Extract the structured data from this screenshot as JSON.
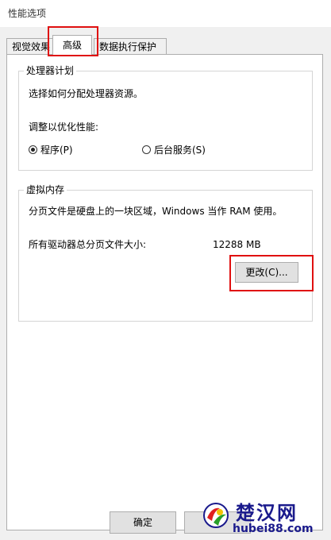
{
  "window": {
    "title": "性能选项"
  },
  "tabs": [
    {
      "label": "视觉效果"
    },
    {
      "label": "高级"
    },
    {
      "label": "数据执行保护"
    }
  ],
  "processor": {
    "title": "处理器计划",
    "description": "选择如何分配处理器资源。",
    "adjust_label": "调整以优化性能:",
    "option_programs": "程序(P)",
    "option_services": "后台服务(S)",
    "selected": "programs"
  },
  "virtual_memory": {
    "title": "虚拟内存",
    "description": "分页文件是硬盘上的一块区域，Windows 当作 RAM 使用。",
    "total_label": "所有驱动器总分页文件大小:",
    "total_value": "12288 MB",
    "change_button": "更改(C)..."
  },
  "footer": {
    "ok_button": "确定"
  },
  "watermark": {
    "brand": "楚汉网",
    "url": "hubei88.com"
  },
  "colors": {
    "highlight": "#e01010",
    "brand": "#1a1a8c"
  }
}
